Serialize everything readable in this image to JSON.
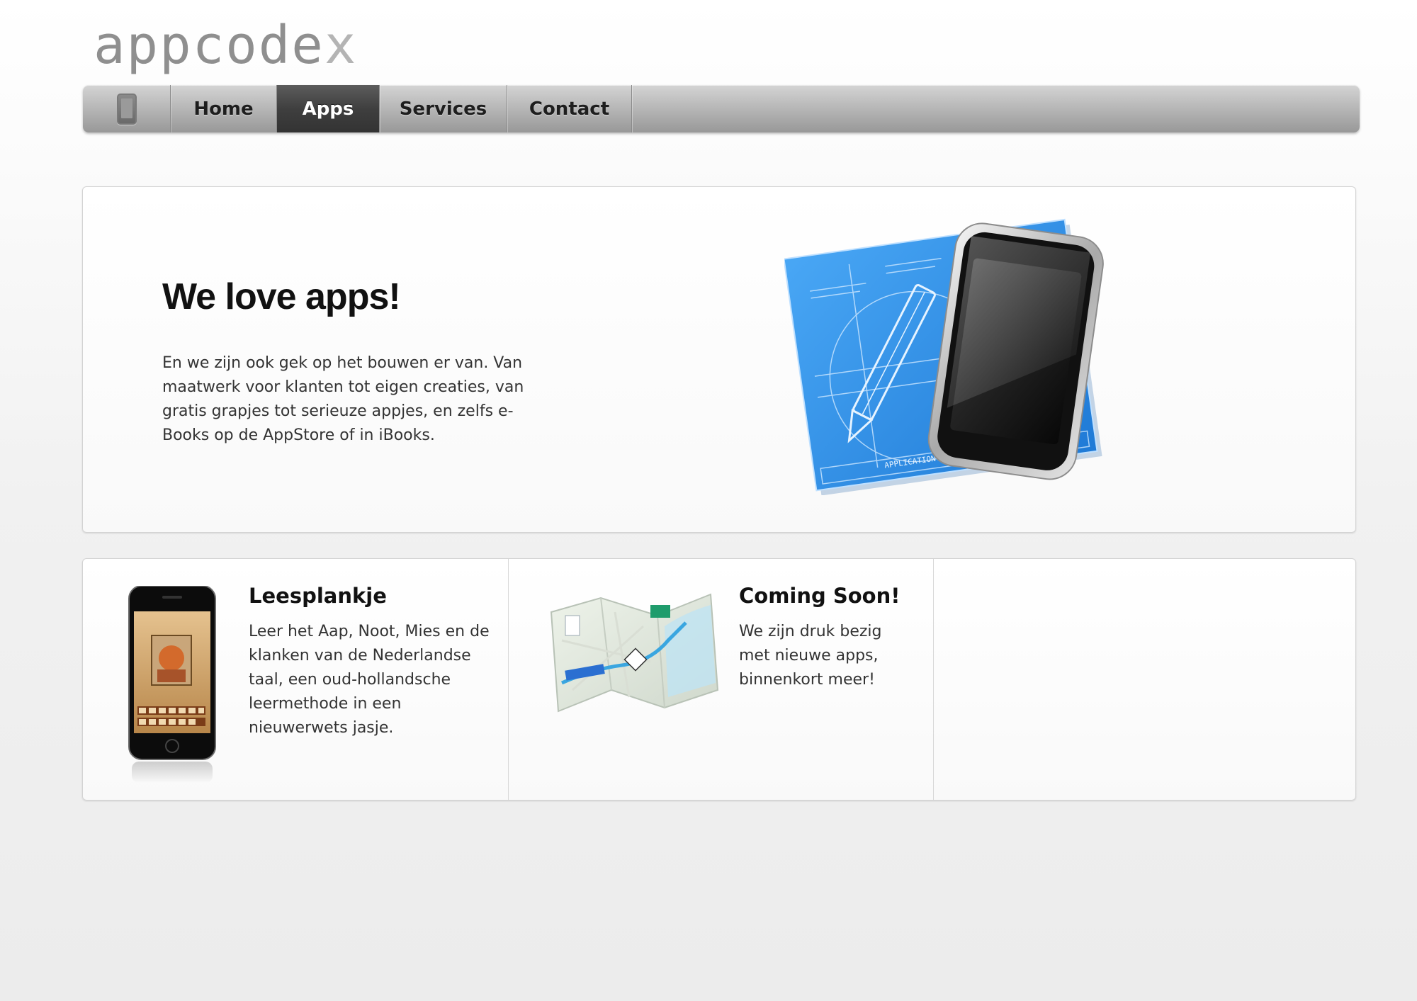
{
  "logo": {
    "main": "appcode",
    "accent": "x"
  },
  "nav": {
    "items": [
      {
        "label": "Home",
        "active": false
      },
      {
        "label": "Apps",
        "active": true
      },
      {
        "label": "Services",
        "active": false
      },
      {
        "label": "Contact",
        "active": false
      }
    ]
  },
  "hero": {
    "title": "We love apps!",
    "text": "En we zijn ook gek op het bouwen er van. Van maatwerk voor klanten tot eigen creaties, van gratis grapjes tot serieuze appjes, en zelfs e-Books op de AppStore of in iBooks.",
    "blueprint_label": "APPLICATION.APP"
  },
  "apps": [
    {
      "title": "Leesplankje",
      "text": "Leer het Aap, Noot, Mies en de klanken van de Nederlandse taal, een oud-hollandsche leermethode in een nieuwerwets jasje."
    },
    {
      "title": "Coming Soon!",
      "text": "We zijn druk bezig met nieuwe apps, binnenkort meer!"
    }
  ],
  "colors": {
    "nav_active": "#3f3f3f",
    "blueprint": "#2f8fe6",
    "map_route": "#3aa6e0"
  }
}
